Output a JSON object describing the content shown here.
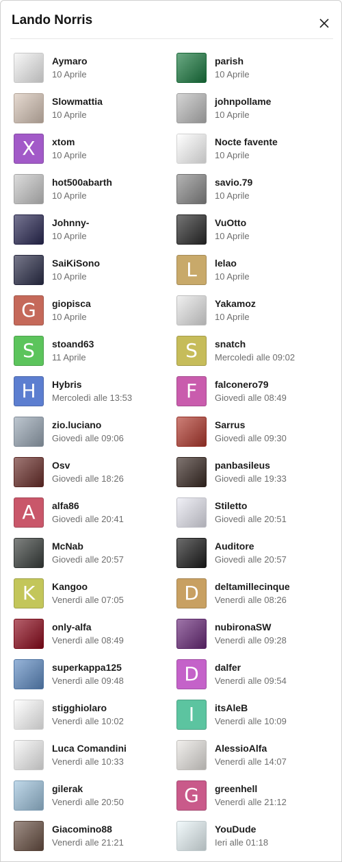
{
  "dialog": {
    "title": "Lando Norris",
    "close_icon": "close-icon"
  },
  "users": [
    {
      "name": "Aymaro",
      "time": "10 Aprile",
      "avatar": {
        "type": "image",
        "icon": "sign-avatar",
        "bg": "#f3f3f3"
      }
    },
    {
      "name": "parish",
      "time": "10 Aprile",
      "avatar": {
        "type": "image",
        "icon": "jersey-avatar",
        "bg": "#1a7a40"
      }
    },
    {
      "name": "Slowmattia",
      "time": "10 Aprile",
      "avatar": {
        "type": "image",
        "icon": "drawing-avatar",
        "bg": "#d8c6b8"
      }
    },
    {
      "name": "johnpollame",
      "time": "10 Aprile",
      "avatar": {
        "type": "image",
        "icon": "photo-avatar",
        "bg": "#bdbdbd"
      }
    },
    {
      "name": "xtom",
      "time": "10 Aprile",
      "avatar": {
        "type": "letter",
        "letter": "X",
        "bg": "#a25ac8"
      }
    },
    {
      "name": "Nocte favente",
      "time": "10 Aprile",
      "avatar": {
        "type": "image",
        "icon": "moon-logo-avatar",
        "bg": "#ffffff"
      }
    },
    {
      "name": "hot500abarth",
      "time": "10 Aprile",
      "avatar": {
        "type": "image",
        "icon": "car-avatar",
        "bg": "#c9c9c9"
      }
    },
    {
      "name": "savio.79",
      "time": "10 Aprile",
      "avatar": {
        "type": "image",
        "icon": "gearshift-avatar",
        "bg": "#8a8a8a"
      }
    },
    {
      "name": "Johnny-",
      "time": "10 Aprile",
      "avatar": {
        "type": "image",
        "icon": "axolotl-avatar",
        "bg": "#2b2a55"
      }
    },
    {
      "name": "VuOtto",
      "time": "10 Aprile",
      "avatar": {
        "type": "image",
        "icon": "car-dark-avatar",
        "bg": "#2a2a2a"
      }
    },
    {
      "name": "SaiKiSono",
      "time": "10 Aprile",
      "avatar": {
        "type": "image",
        "icon": "face-avatar",
        "bg": "#2c2e4a"
      }
    },
    {
      "name": "lelao",
      "time": "10 Aprile",
      "avatar": {
        "type": "letter",
        "letter": "L",
        "bg": "#c8a96a"
      }
    },
    {
      "name": "giopisca",
      "time": "10 Aprile",
      "avatar": {
        "type": "letter",
        "letter": "G",
        "bg": "#c5695a"
      }
    },
    {
      "name": "Yakamoz",
      "time": "10 Aprile",
      "avatar": {
        "type": "image",
        "icon": "car-star-avatar",
        "bg": "#e7e7e7"
      }
    },
    {
      "name": "stoand63",
      "time": "11 Aprile",
      "avatar": {
        "type": "letter",
        "letter": "S",
        "bg": "#5cc45c"
      }
    },
    {
      "name": "snatch",
      "time": "Mercoledì alle 09:02",
      "avatar": {
        "type": "letter",
        "letter": "S",
        "bg": "#c6bc5a"
      }
    },
    {
      "name": "Hybris",
      "time": "Mercoledì alle 13:53",
      "avatar": {
        "type": "letter",
        "letter": "H",
        "bg": "#5c7ed0"
      }
    },
    {
      "name": "falconero79",
      "time": "Giovedì alle 08:49",
      "avatar": {
        "type": "letter",
        "letter": "F",
        "bg": "#c95cad"
      }
    },
    {
      "name": "zio.luciano",
      "time": "Giovedì alle 09:06",
      "avatar": {
        "type": "image",
        "icon": "bike-avatar",
        "bg": "#9aa8b6"
      }
    },
    {
      "name": "Sarrus",
      "time": "Giovedì alle 09:30",
      "avatar": {
        "type": "image",
        "icon": "red-car-avatar",
        "bg": "#b23a2e"
      }
    },
    {
      "name": "Osv",
      "time": "Giovedì alle 18:26",
      "avatar": {
        "type": "image",
        "icon": "engine-avatar",
        "bg": "#6b2e2a"
      }
    },
    {
      "name": "panbasileus",
      "time": "Giovedì alle 19:33",
      "avatar": {
        "type": "image",
        "icon": "night-car-avatar",
        "bg": "#3a2a24"
      }
    },
    {
      "name": "alfa86",
      "time": "Giovedì alle 20:41",
      "avatar": {
        "type": "letter",
        "letter": "A",
        "bg": "#c9576a"
      }
    },
    {
      "name": "Stiletto",
      "time": "Giovedì alle 20:51",
      "avatar": {
        "type": "image",
        "icon": "pirate-avatar",
        "bg": "#e8e8f2"
      }
    },
    {
      "name": "McNab",
      "time": "Giovedì alle 20:57",
      "avatar": {
        "type": "image",
        "icon": "red-car-dark-avatar",
        "bg": "#3a3f3c"
      }
    },
    {
      "name": "Auditore",
      "time": "Giovedì alle 20:57",
      "avatar": {
        "type": "image",
        "icon": "assassin-logo-avatar",
        "bg": "#1c1c1c"
      }
    },
    {
      "name": "Kangoo",
      "time": "Venerdì alle 07:05",
      "avatar": {
        "type": "letter",
        "letter": "K",
        "bg": "#c3c65a"
      }
    },
    {
      "name": "deltamillecinque",
      "time": "Venerdì alle 08:26",
      "avatar": {
        "type": "letter",
        "letter": "D",
        "bg": "#c8a062"
      }
    },
    {
      "name": "only-alfa",
      "time": "Venerdì alle 08:49",
      "avatar": {
        "type": "image",
        "icon": "dark-red-avatar",
        "bg": "#8e0a1c"
      }
    },
    {
      "name": "nubironaSW",
      "time": "Venerdì alle 09:28",
      "avatar": {
        "type": "image",
        "icon": "purple-car-avatar",
        "bg": "#6a2a7a"
      }
    },
    {
      "name": "superkappa125",
      "time": "Venerdì alle 09:48",
      "avatar": {
        "type": "image",
        "icon": "mountain-avatar",
        "bg": "#5f8cc4"
      }
    },
    {
      "name": "dalfer",
      "time": "Venerdì alle 09:54",
      "avatar": {
        "type": "letter",
        "letter": "D",
        "bg": "#c462c9"
      }
    },
    {
      "name": "stigghiolaro",
      "time": "Venerdì alle 10:02",
      "avatar": {
        "type": "image",
        "icon": "darth-vader-avatar",
        "bg": "#ffffff"
      }
    },
    {
      "name": "itsAleB",
      "time": "Venerdì alle 10:09",
      "avatar": {
        "type": "letter",
        "letter": "I",
        "bg": "#5cc4a0"
      }
    },
    {
      "name": "Luca Comandini",
      "time": "Venerdì alle 10:33",
      "avatar": {
        "type": "image",
        "icon": "person-avatar",
        "bg": "#f5f5f5"
      }
    },
    {
      "name": "AlessioAlfa",
      "time": "Venerdì alle 14:07",
      "avatar": {
        "type": "image",
        "icon": "man-glasses-avatar",
        "bg": "#e9e6e2"
      }
    },
    {
      "name": "gilerak",
      "time": "Venerdì alle 20:50",
      "avatar": {
        "type": "image",
        "icon": "cartoon-avatar",
        "bg": "#9ec3dd"
      }
    },
    {
      "name": "greenhell",
      "time": "Venerdì alle 21:12",
      "avatar": {
        "type": "letter",
        "letter": "G",
        "bg": "#c95a8a"
      }
    },
    {
      "name": "Giacomino88",
      "time": "Venerdì alle 21:21",
      "avatar": {
        "type": "image",
        "icon": "hand-avatar",
        "bg": "#6a5144"
      }
    },
    {
      "name": "YouDude",
      "time": "Ieri alle 01:18",
      "avatar": {
        "type": "image",
        "icon": "blue-bird-avatar",
        "bg": "#eaf6f9"
      }
    }
  ]
}
